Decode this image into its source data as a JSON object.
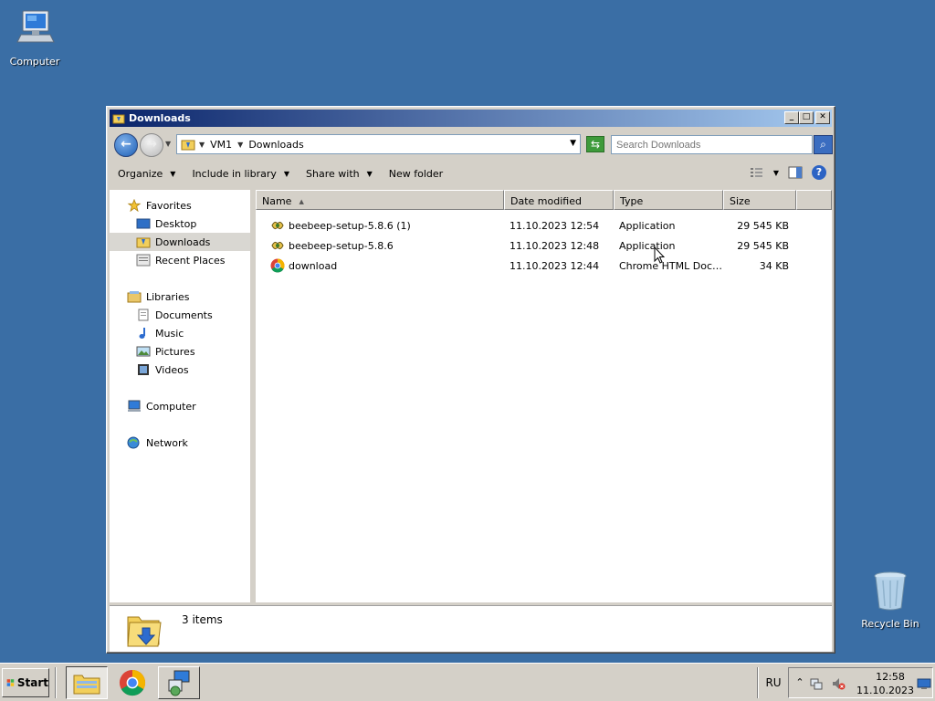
{
  "desktop": {
    "icons": [
      {
        "label": "Computer",
        "icon": "computer-icon"
      },
      {
        "label": "Recycle Bin",
        "icon": "recycle-bin-icon"
      }
    ]
  },
  "window": {
    "title": "Downloads",
    "buttons": {
      "minimize": "_",
      "maximize": "□",
      "close": "✕"
    },
    "address": {
      "breadcrumbs": [
        "VM1",
        "Downloads"
      ]
    },
    "search": {
      "placeholder": "Search Downloads"
    },
    "toolbar": {
      "organize": "Organize",
      "include_in_library": "Include in library",
      "share_with": "Share with",
      "new_folder": "New folder"
    },
    "nav": {
      "favorites": "Favorites",
      "desktop": "Desktop",
      "downloads": "Downloads",
      "recent_places": "Recent Places",
      "libraries": "Libraries",
      "documents": "Documents",
      "music": "Music",
      "pictures": "Pictures",
      "videos": "Videos",
      "computer": "Computer",
      "network": "Network"
    },
    "columns": {
      "name": "Name",
      "date_modified": "Date modified",
      "type": "Type",
      "size": "Size"
    },
    "files": [
      {
        "name": "beebeep-setup-5.8.6 (1)",
        "date": "11.10.2023 12:54",
        "type": "Application",
        "size": "29 545 KB",
        "icon": "installer-icon"
      },
      {
        "name": "beebeep-setup-5.8.6",
        "date": "11.10.2023 12:48",
        "type": "Application",
        "size": "29 545 KB",
        "icon": "installer-icon"
      },
      {
        "name": "download",
        "date": "11.10.2023 12:44",
        "type": "Chrome HTML Docu...",
        "size": "34 KB",
        "icon": "chrome-icon"
      }
    ],
    "status": {
      "count": "3 items"
    }
  },
  "taskbar": {
    "start_label": "Start",
    "language": "RU",
    "clock_time": "12:58",
    "clock_date": "11.10.2023"
  },
  "colors": {
    "desktop": "#3a6ea5",
    "title_start": "#0a246a",
    "title_end": "#a6caf0",
    "face": "#d4d0c8"
  }
}
